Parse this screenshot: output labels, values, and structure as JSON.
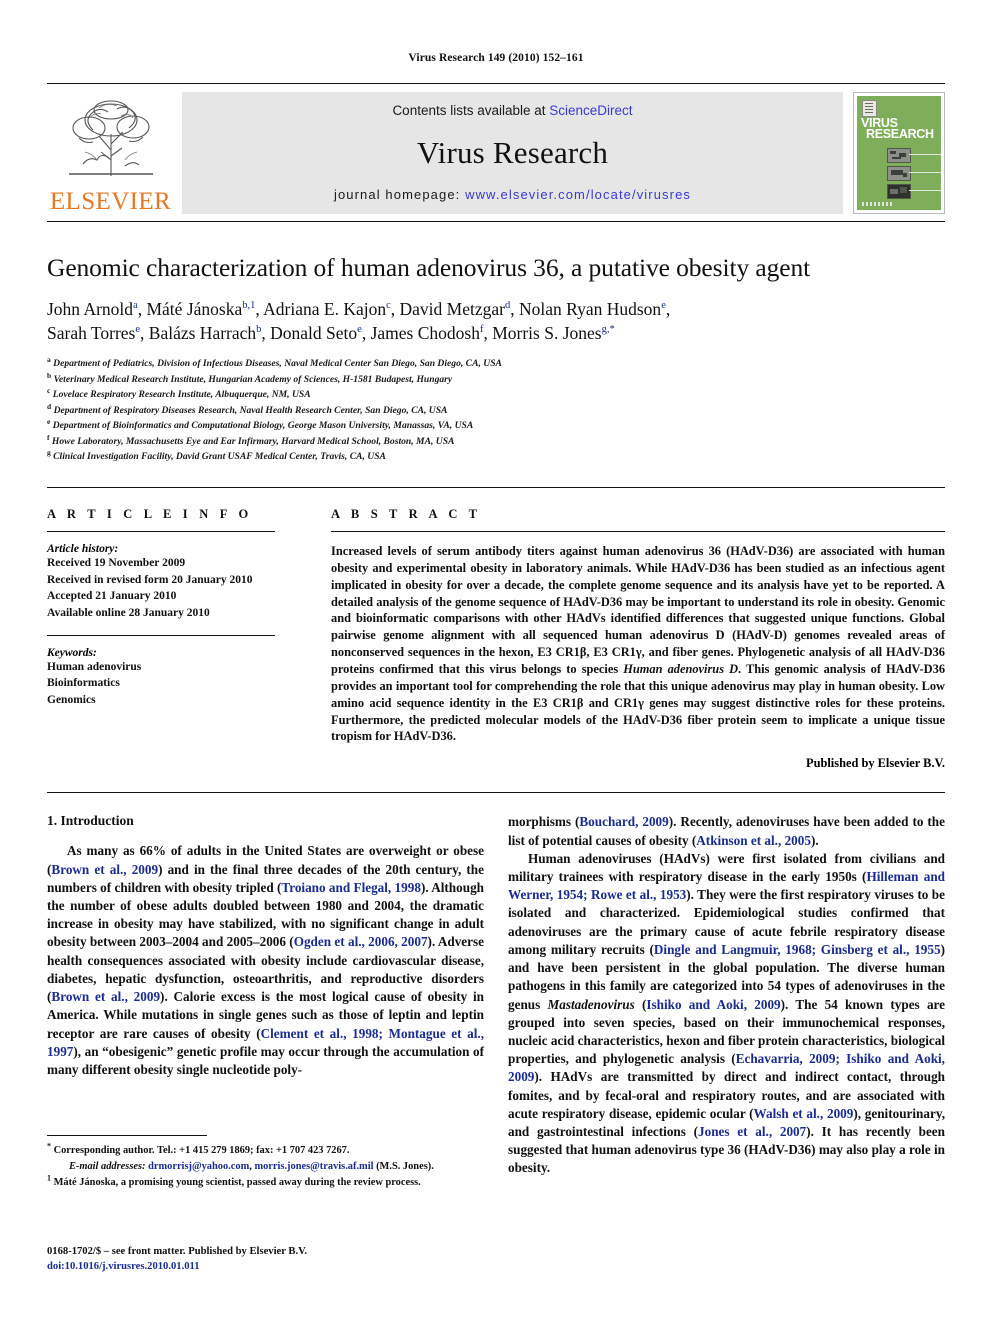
{
  "running_head": "Virus Research 149 (2010) 152–161",
  "masthead": {
    "publisher_name": "ELSEVIER",
    "contents_prefix": "Contents lists available at ",
    "contents_link": "ScienceDirect",
    "journal_title": "Virus Research",
    "homepage_prefix": "journal homepage: ",
    "homepage_url": "www.elsevier.com/locate/virusres",
    "cover_title_line1": "VIRUS",
    "cover_title_line2": "RESEARCH",
    "accent_color": "#E87722",
    "link_color": "#3a3ad0",
    "cover_color": "#7fae5a"
  },
  "paper": {
    "title": "Genomic characterization of human adenovirus 36, a putative obesity agent",
    "authors_line1_html": "John Arnold<sup>a</sup>, Máté Jánoska<sup>b,1</sup>, Adriana E. Kajon<sup>c</sup>, David Metzgar<sup>d</sup>, Nolan Ryan Hudson<sup>e</sup>,",
    "authors_line2_html": "Sarah Torres<sup>e</sup>, Balázs Harrach<sup>b</sup>, Donald Seto<sup>e</sup>, James Chodosh<sup>f</sup>, Morris S. Jones<sup>g,</sup><sup>*</sup>",
    "affiliations": [
      {
        "mark": "a",
        "text": "Department of Pediatrics, Division of Infectious Diseases, Naval Medical Center San Diego, San Diego, CA, USA"
      },
      {
        "mark": "b",
        "text": "Veterinary Medical Research Institute, Hungarian Academy of Sciences, H-1581 Budapest, Hungary"
      },
      {
        "mark": "c",
        "text": "Lovelace Respiratory Research Institute, Albuquerque, NM, USA"
      },
      {
        "mark": "d",
        "text": "Department of Respiratory Diseases Research, Naval Health Research Center, San Diego, CA, USA"
      },
      {
        "mark": "e",
        "text": "Department of Bioinformatics and Computational Biology, George Mason University, Manassas, VA, USA"
      },
      {
        "mark": "f",
        "text": "Howe Laboratory, Massachusetts Eye and Ear Infirmary, Harvard Medical School, Boston, MA, USA"
      },
      {
        "mark": "g",
        "text": "Clinical Investigation Facility, David Grant USAF Medical Center, Travis, CA, USA"
      }
    ]
  },
  "article_info": {
    "heading": "A R T I C L E   I N F O",
    "history_label": "Article history:",
    "history": [
      "Received 19 November 2009",
      "Received in revised form 20 January 2010",
      "Accepted 21 January 2010",
      "Available online 28 January 2010"
    ],
    "keywords_label": "Keywords:",
    "keywords": [
      "Human adenovirus",
      "Bioinformatics",
      "Genomics"
    ]
  },
  "abstract": {
    "heading": "A B S T R A C T",
    "body_html": "Increased levels of serum antibody titers against human adenovirus 36 (HAdV-D36) are associated with human obesity and experimental obesity in laboratory animals. While HAdV-D36 has been studied as an infectious agent implicated in obesity for over a decade, the complete genome sequence and its analysis have yet to be reported. A detailed analysis of the genome sequence of HAdV-D36 may be important to understand its role in obesity. Genomic and bioinformatic comparisons with other HAdVs identified differences that suggested unique functions. Global pairwise genome alignment with all sequenced human adenovirus D (HAdV-D) genomes revealed areas of nonconserved sequences in the hexon, E3 CR1β, E3 CR1γ, and fiber genes. Phylogenetic analysis of all HAdV-D36 proteins confirmed that this virus belongs to species <i>Human adenovirus D</i>. This genomic analysis of HAdV-D36 provides an important tool for comprehending the role that this unique adenovirus may play in human obesity. Low amino acid sequence identity in the E3 CR1β and CR1γ genes may suggest distinctive roles for these proteins. Furthermore, the predicted molecular models of the HAdV-D36 fiber protein seem to implicate a unique tissue tropism for HAdV-D36.",
    "published_by": "Published by Elsevier B.V."
  },
  "introduction": {
    "section_title": "1.  Introduction",
    "left_paragraph_html": "As many as 66% of adults in the United States are overweight or obese (<span class=\"cite\">Brown et al., 2009</span>) and in the final three decades of the 20th century, the numbers of children with obesity tripled (<span class=\"cite\">Troiano and Flegal, 1998</span>). Although the number of obese adults doubled between 1980 and 2004, the dramatic increase in obesity may have stabilized, with no significant change in adult obesity between 2003–2004 and 2005–2006 (<span class=\"cite\">Ogden et al., 2006, 2007</span>). Adverse health consequences associated with obesity include cardiovascular disease, diabetes, hepatic dysfunction, osteoarthritis, and reproductive disorders (<span class=\"cite\">Brown et al., 2009</span>). Calorie excess is the most logical cause of obesity in America. While mutations in single genes such as those of leptin and leptin receptor are rare causes of obesity (<span class=\"cite\">Clement et al., 1998; Montague et al., 1997</span>), an “obesigenic” genetic profile may occur through the accumulation of many different obesity single nucleotide poly-",
    "right_paragraph1_html": "morphisms (<span class=\"cite\">Bouchard, 2009</span>). Recently, adenoviruses have been added to the list of potential causes of obesity (<span class=\"cite\">Atkinson et al., 2005</span>).",
    "right_paragraph2_html": "Human adenoviruses (HAdVs) were first isolated from civilians and military trainees with respiratory disease in the early 1950s (<span class=\"cite\">Hilleman and Werner, 1954; Rowe et al., 1953</span>). They were the first respiratory viruses to be isolated and characterized. Epidemiological studies confirmed that adenoviruses are the primary cause of acute febrile respiratory disease among military recruits (<span class=\"cite\">Dingle and Langmuir, 1968; Ginsberg et al., 1955</span>) and have been persistent in the global population. The diverse human pathogens in this family are categorized into 54 types of adenoviruses in the genus <i>Mastadenovirus</i> (<span class=\"cite\">Ishiko and Aoki, 2009</span>). The 54 known types are grouped into seven species, based on their immunochemical responses, nucleic acid characteristics, hexon and fiber protein characteristics, biological properties, and phylogenetic analysis (<span class=\"cite\">Echavarria, 2009; Ishiko and Aoki, 2009</span>). HAdVs are transmitted by direct and indirect contact, through fomites, and by fecal-oral and respiratory routes, and are associated with acute respiratory disease, epidemic ocular (<span class=\"cite\">Walsh et al., 2009</span>), genitourinary, and gastrointestinal infections (<span class=\"cite\">Jones et al., 2007</span>). It has recently been suggested that human adenovirus type 36 (HAdV-D36) may also play a role in obesity."
  },
  "footnotes": {
    "corresponding_html": "<sup>*</sup> Corresponding author. Tel.: +1 415 279 1869; fax: +1 707 423 7267.",
    "email_html": "<span class=\"em\">E-mail addresses:</span> <span class=\"mail\">drmorrisj@yahoo.com</span>, <span class=\"mail\">morris.jones@travis.af.mil</span> (M.S. Jones).",
    "note1_html": "<sup>1</sup> Máté Jánoska, a promising young scientist, passed away during the review process."
  },
  "imprint": {
    "front_matter": "0168-1702/$ – see front matter. Published by Elsevier B.V.",
    "doi": "doi:10.1016/j.virusres.2010.01.011"
  }
}
